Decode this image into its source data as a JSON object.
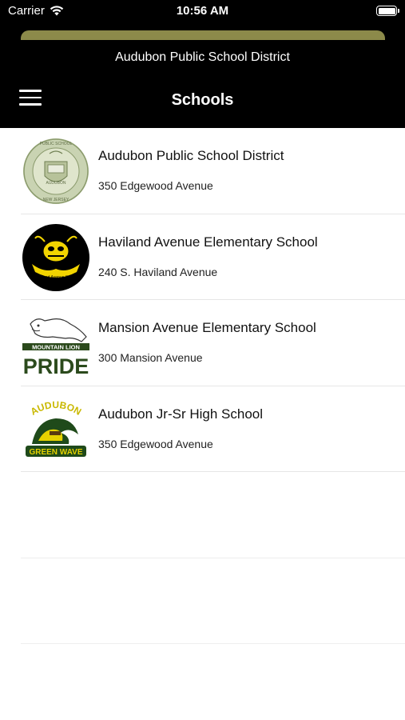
{
  "status_bar": {
    "carrier": "Carrier",
    "time": "10:56 AM",
    "wifi_icon": "wifi-icon",
    "battery_icon": "battery-icon"
  },
  "header": {
    "accent_color": "#8c8a4a",
    "district_name": "Audubon Public School District",
    "title": "Schools",
    "menu_icon": "hamburger-menu-icon"
  },
  "schools": [
    {
      "name": "Audubon Public School District",
      "address": "350 Edgewood Avenue",
      "logo_text": "AUDUBON PUBLIC SCHOOL DISTRICT NEW JERSEY",
      "logo_icon": "district-seal-logo"
    },
    {
      "name": "Haviland Avenue Elementary School",
      "address": "240 S. Haviland Avenue",
      "logo_text": "HAS Haviland Avenue School",
      "logo_icon": "hornet-mascot-logo"
    },
    {
      "name": "Mansion Avenue Elementary School",
      "address": "300 Mansion Avenue",
      "logo_text": "MOUNTAIN LION PRIDE",
      "logo_icon": "mountain-lion-logo"
    },
    {
      "name": "Audubon Jr-Sr High School",
      "address": "350 Edgewood Avenue",
      "logo_text": "AUDUBON GREEN WAVE",
      "logo_icon": "green-wave-logo"
    }
  ]
}
